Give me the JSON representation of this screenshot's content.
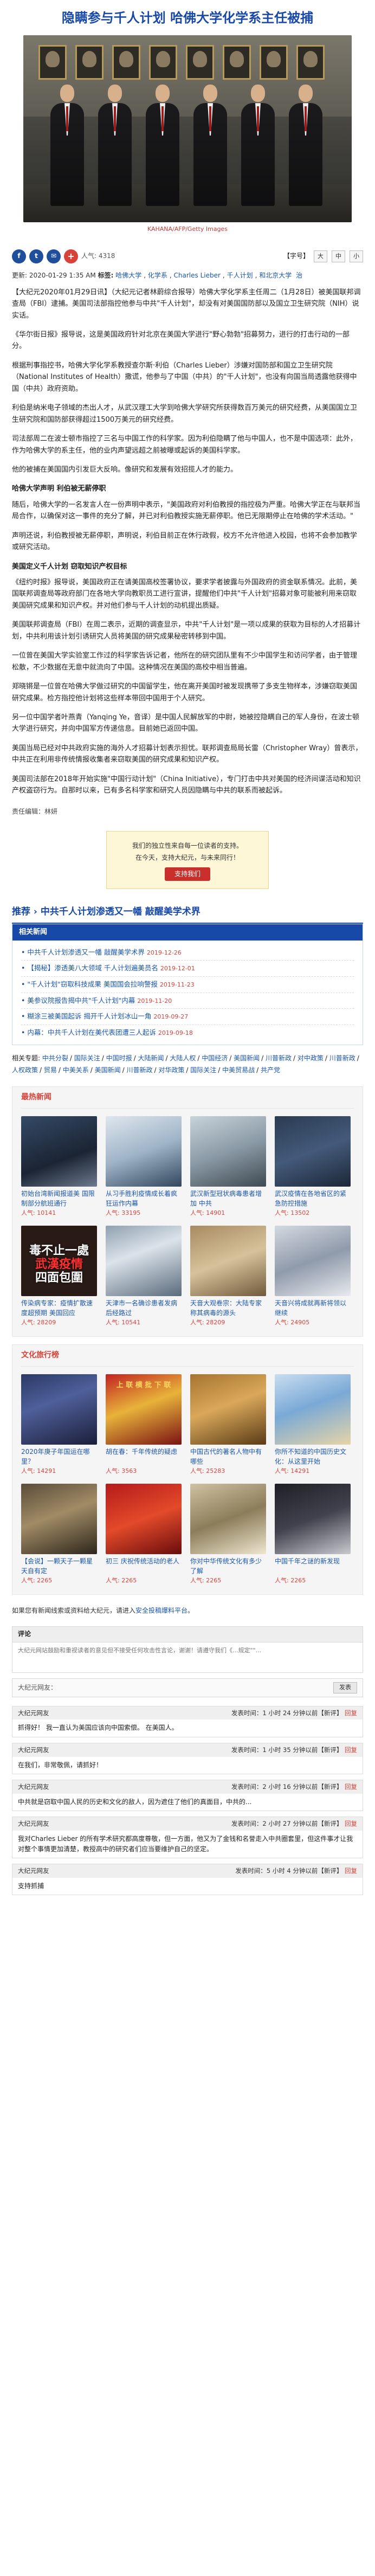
{
  "title": "隐瞒参与千人计划 哈佛大学化学系主任被捕",
  "photo_caption": "KAHANA/AFP/Getty Images",
  "share": {
    "views": "人气: 4318",
    "font_label": "【字号】",
    "font_big": "大",
    "font_mid": "中",
    "font_small": "小"
  },
  "meta": {
    "updated": "更新: 2020-01-29 1:35 AM",
    "tags_label": "标签:",
    "tags": [
      "哈佛大学",
      "化学系",
      "Charles Lieber",
      "千人计划",
      "和北京大学"
    ],
    "extra_tag": "治"
  },
  "article": {
    "paragraphs": [
      "【大纪元2020年01月29日讯】（大纪元记者林蔚综合报导）哈佛大学化学系主任周二（1月28日）被美国联邦调查局（FBI）逮捕。美国司法部指控他参与中共\"千人计划\"，却没有对美国国防部以及国立卫生研究院（NIH）说实话。",
      "《华尔街日报》报导说，这是美国政府针对北京在美国大学进行\"野心勃勃\"招募努力，进行的打击行动的一部分。",
      "根据刑事指控书，哈佛大学化学系教授查尔斯·利伯（Charles Lieber）涉嫌对国防部和国立卫生研究院（National Institutes of Health）撒谎，他参与了中国（中共）的\"千人计划\"，也没有向国当局透露他获得中国（中共）政府资助。",
      "利伯是纳米电子领域的杰出人才，从武汉理工大学到哈佛大学研究所获得数百万美元的研究经费，从美国国立卫生研究院和国防部获得超过1500万美元的研究经费。",
      "司法部周二在波士顿市指控了三名与中国工作的科学家。因为利伯隐瞒了他与中国人，也不是中国选项：此外，作为哈佛大学的系主任，他的业内声望远超之前被曝或起诉的美国科学家。",
      "他的被捕在美国国内引发巨大反响。像研究和发展有效招揽人才的能力。"
    ],
    "h1": "哈佛大学声明 利伯被无薪停职",
    "paragraphs2": [
      "随后，哈佛大学的一名发言人在一份声明中表示，\"美国政府对利伯教授的指控极为严重。哈佛大学正在与联邦当局合作，以确保对这一事件的充分了解，并已对利伯教授实施无薪停职。他已无限期停止在哈佛的学术活动。\""
    ],
    "p3": "声明还说，利伯教授被无薪停职，声明说，利伯目前正在休行政假，校方不允许他进入校园，也将不会参加教学或研究活动。",
    "h2": "美国定义千人计划 窃取知识产权目标",
    "paragraphs3": [
      "《纽约时报》报导说，美国政府正在请美国高校签署协议，要求学者披露与外国政府的资金联系情况。此前，美国联邦调查局等政府部门在各地大学向教职员工进行宣讲，提醒他们中共\"千人计划\"招募对象可能被利用来窃取美国研究成果和知识产权。并对他们参与千人计划的动机提出质疑。",
      "美国联邦调查局（FBI）在周二表示，近期的调查显示，中共\"千人计划\"是一项以成果的获取为目标的人才招募计划，中共利用该计划引诱研究人员将美国的研究成果秘密转移到中国。",
      "一位曾在美国大学实验室工作过的科学家告诉记者，他所在的研究团队里有不少中国学生和访问学者，由于管理松散，不少数据在无意中就流向了中国。这种情况在美国的高校中相当普遍。",
      "郑晓锵是一位曾在哈佛大学做过研究的中国留学生，他在离开美国时被发现携带了多支生物样本，涉嫌窃取美国研究成果。检方指控他计划将这些样本带回中国用于个人研究。",
      "另一位中国学者叶燕青（Yanqing Ye，音译）是中国人民解放军的中尉，她被控隐瞒自己的军人身份，在波士顿大学进行研究，并向中国军方传递信息。目前她已返回中国。",
      "美国当局已经对中共政府实施的海外人才招募计划表示担忧。联邦调查局局长雷（Christopher Wray）曾表示，中共正在利用非传统情报收集者来窃取美国的研究成果和知识产权。",
      "美国司法部在2018年开始实施\"中国行动计划\"（China Initiative），专门打击中共对美国的经济间谍活动和知识产权盗窃行为。自那时以来，已有多名科学家和研究人员因隐瞒与中共的联系而被起诉。"
    ],
    "editor": "责任编辑：林妍"
  },
  "donate": {
    "line1": "我们的独立性来自每一位读者的支持。",
    "line2": "在今天，支持大纪元，与未来同行！",
    "button": "支持我们"
  },
  "recommend": {
    "title": "推荐 › 中共千人计划渗透又一幡 敲醒美学术界",
    "related_header": "相关新闻",
    "items": [
      {
        "text": "中共千人计划渗透又一幡 敲醒美学术界",
        "date": "2019-12-26"
      },
      {
        "text": "【揭秘】渗透美八大领域 千人计划遍美员名",
        "date": "2019-12-01"
      },
      {
        "text": "\"千人计划\"窃取科技成果 美国国会拉响警报",
        "date": "2019-11-23"
      },
      {
        "text": "美参议院报告揭中共\"千人计划\"内幕",
        "date": "2019-11-20"
      },
      {
        "text": "糊涂三被美国起诉 揭开千人计划冰山一角",
        "date": "2019-09-27"
      },
      {
        "text": "内幕：中共千人计划在美代表团遭三人起诉",
        "date": "2019-09-18"
      }
    ]
  },
  "keywords": {
    "label": "相关专题:",
    "items": [
      "中共分裂",
      "国际关注",
      "中国时报",
      "大陆新闻",
      "大陆人权",
      "中国经济",
      "美国新闻",
      "川普新政",
      "对中政策",
      "川普新政",
      "人权政策",
      "贸易",
      "中美关系",
      "美国新闻",
      "川普新政",
      "对华政策",
      "国际关注",
      "中美贸易战",
      "共产党"
    ]
  },
  "hot": {
    "title": "最热新闻",
    "items": [
      {
        "caption": "初始台湾新闻报道美 国限制部分航班通行",
        "count": "人气: 10141"
      },
      {
        "caption": "从习手胜利疫情成长着疯狂运作内幕",
        "count": "人气: 33195"
      },
      {
        "caption": "武汉新型冠状病毒患者增加 中共",
        "count": "人气: 14901"
      },
      {
        "caption": "武汉疫情在各地省区的紧急防控措施",
        "count": "人气: 13502"
      },
      {
        "caption": "传染病专家：疫情扩散速度超预期 美国回应",
        "count": "人气: 28209"
      },
      {
        "caption": "天津市一名确诊患者发病后经路过",
        "count": "人气: 10541"
      },
      {
        "caption": "天音大观卷宗：大陆专家称其病毒的源头",
        "count": "人气: 28209"
      },
      {
        "caption": "天音兴将成就再新将领以继续",
        "count": "人气: 24905"
      }
    ],
    "virus_overlay": [
      "毒不止一處",
      "武漢疫情",
      "四面包圍"
    ]
  },
  "culture": {
    "title": "文化旅行榜",
    "items": [
      {
        "caption": "2020年庚子年国运在哪里？",
        "count": "人气: 14291"
      },
      {
        "caption": "胡在春：千年传统的疑虑",
        "count": "人气: 3563"
      },
      {
        "caption": "中国古代的著名人物中有哪些",
        "count": "人气: 25283"
      },
      {
        "caption": "你所不知道的中国历史文化：从这里开始",
        "count": "人气: 14291"
      },
      {
        "caption": "【会说】一颗天子一颗星 天自有定 ",
        "count": "人气: 2265"
      },
      {
        "caption": "初三 庆祝传统活动的老人",
        "count": "人气: 2265"
      },
      {
        "caption": "你对中华传统文化有多少了解",
        "count": "人气: 2265"
      },
      {
        "caption": "中国千年之谜的新发现",
        "count": "人气: 2265"
      }
    ],
    "couplet": [
      "上 联",
      "横 批",
      "下 联"
    ]
  },
  "notice": {
    "text": "如果您有新闻线索或资料给大纪元，请进入",
    "link": "安全投稿爆料平台",
    "end": "。"
  },
  "comment_box": {
    "label": "评论",
    "placeholder": "大纪元网站鼓励和重视读者的意见但不接受任何攻击性言论，谢谢！请遵守我们《...规定\"\"..."
  },
  "comment_form": {
    "name": "大纪元网友：",
    "submit": "发表"
  },
  "comments": [
    {
      "user": "大纪元网友",
      "time": "发表时间：1 小时 24 分钟以前【新评】",
      "reply": "回复",
      "text": "抓得好！\n我一直认为美国应该向中国索偿。 在美国人。"
    },
    {
      "user": "大纪元网友",
      "time": "发表时间：1 小时 35 分钟以前【新评】",
      "reply": "回复",
      "text": "在我们，非常敬佩，请抓好！"
    },
    {
      "user": "大纪元网友",
      "time": "发表时间：2 小时 16 分钟以前【新评】",
      "reply": "回复",
      "text": "中共就是窃取中国人民的历史和文化的敌人，因为遮住了他们的真面目，中共的..."
    },
    {
      "user": "大纪元网友",
      "time": "发表时间：2 小时 27 分钟以前【新评】",
      "reply": "回复",
      "text": "我对Charles Lieber 的所有学术研究都高度尊敬，但一方面，他又为了金钱和名誉走入中共圈套里，但这件事才让我对整个事情更加清楚，教授高中的研究者们应当要维护自己的坚定。"
    },
    {
      "user": "大纪元网友",
      "time": "发表时间：5 小时 4 分钟以前【新评】",
      "reply": "回复",
      "text": "支持抓捕"
    }
  ]
}
